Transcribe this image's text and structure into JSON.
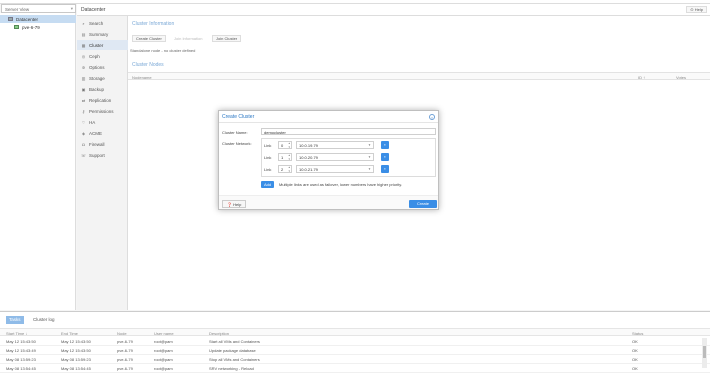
{
  "view_selector": {
    "label": "Server View"
  },
  "tree": {
    "datacenter": "Datacenter",
    "node": "pve-6-79"
  },
  "header": {
    "title": "Datacenter",
    "help": "Help"
  },
  "nav": [
    {
      "icon": "search-icon",
      "label": "Search"
    },
    {
      "icon": "summary-icon",
      "label": "Summary"
    },
    {
      "icon": "cluster-icon",
      "label": "Cluster"
    },
    {
      "icon": "ceph-icon",
      "label": "Ceph"
    },
    {
      "icon": "gear-icon",
      "label": "Options"
    },
    {
      "icon": "storage-icon",
      "label": "Storage"
    },
    {
      "icon": "backup-icon",
      "label": "Backup"
    },
    {
      "icon": "replication-icon",
      "label": "Replication"
    },
    {
      "icon": "key-icon",
      "label": "Permissions"
    },
    {
      "icon": "heart-icon",
      "label": "HA"
    },
    {
      "icon": "certificate-icon",
      "label": "ACME"
    },
    {
      "icon": "shield-icon",
      "label": "Firewall"
    },
    {
      "icon": "support-icon",
      "label": "Support"
    }
  ],
  "content": {
    "cluster_info_title": "Cluster Information",
    "create_cluster_btn": "Create Cluster",
    "join_info_btn": "Join Information",
    "join_cluster_btn": "Join Cluster",
    "standalone_text": "Standalone node - no cluster defined",
    "cluster_nodes_title": "Cluster Nodes",
    "nodes_columns": [
      "Nodename",
      "ID ↑",
      "Votes"
    ]
  },
  "modal": {
    "title": "Create Cluster",
    "cluster_name_label": "Cluster Name:",
    "cluster_name_value": "democluster",
    "cluster_network_label": "Cluster Network:",
    "links": [
      {
        "label": "Link",
        "num": "0",
        "ip": "10.0.19.79"
      },
      {
        "label": "Link",
        "num": "1",
        "ip": "10.0.20.79"
      },
      {
        "label": "Link",
        "num": "2",
        "ip": "10.0.21.79"
      }
    ],
    "add_btn": "Add",
    "add_note": "Multiple links are used as failover, lower numbers have higher priority.",
    "help_btn": "Help",
    "create_btn": "Create"
  },
  "log": {
    "tabs": [
      "Tasks",
      "Cluster log"
    ],
    "columns": [
      "Start Time ↓",
      "End Time",
      "Node",
      "User name",
      "Description",
      "Status"
    ],
    "rows": [
      [
        "May 12 15:43:50",
        "May 12 15:43:50",
        "pve-6-79",
        "root@pam",
        "Start all VMs and Containers",
        "OK"
      ],
      [
        "May 12 15:43:49",
        "May 12 15:43:50",
        "pve-6-79",
        "root@pam",
        "Update package database",
        "OK"
      ],
      [
        "May 08 13:59:23",
        "May 08 13:59:23",
        "pve-6-79",
        "root@pam",
        "Stop all VMs and Containers",
        "OK"
      ],
      [
        "May 08 13:54:45",
        "May 08 13:54:45",
        "pve-6-79",
        "root@pam",
        "SRV networking - Reload",
        "OK"
      ]
    ]
  }
}
